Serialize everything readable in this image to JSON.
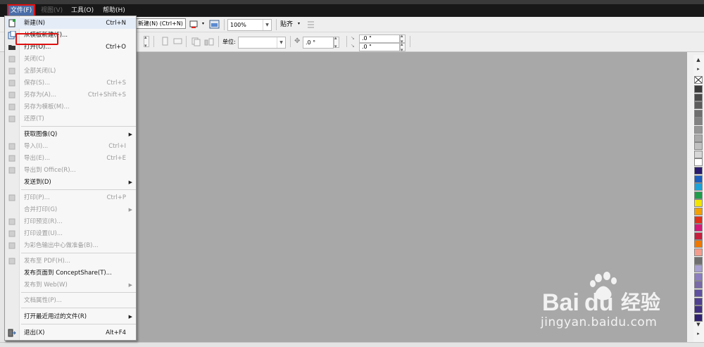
{
  "menubar": {
    "items": [
      {
        "label": "文件(F)",
        "state": "active"
      },
      {
        "label": "视图(V)",
        "state": "disabled"
      },
      {
        "label": "工具(O)",
        "state": "normal"
      },
      {
        "label": "帮助(H)",
        "state": "normal"
      }
    ]
  },
  "toolbar": {
    "tooltip": "新建(N) (Ctrl+N)",
    "zoom_value": "100%",
    "snap_label": "贴齐",
    "unit_label": "单位:",
    "unit_value": "",
    "rotate_value": ".0 °",
    "dup_x_value": ".0 \"",
    "dup_y_value": ".0 \""
  },
  "file_menu": {
    "items": [
      {
        "label": "新建(N)",
        "shortcut": "Ctrl+N",
        "enabled": true,
        "submenu": false,
        "icon": "new-document-icon"
      },
      {
        "label": "从模板新建(F)...",
        "shortcut": "",
        "enabled": true,
        "submenu": false,
        "icon": "template-icon"
      },
      {
        "label": "打开(O)...",
        "shortcut": "Ctrl+O",
        "enabled": true,
        "submenu": false,
        "icon": "open-folder-icon"
      },
      {
        "label": "关闭(C)",
        "shortcut": "",
        "enabled": false,
        "submenu": false,
        "icon": "close-document-icon"
      },
      {
        "label": "全部关闭(L)",
        "shortcut": "",
        "enabled": false,
        "submenu": false,
        "icon": "close-all-icon"
      },
      {
        "label": "保存(S)...",
        "shortcut": "Ctrl+S",
        "enabled": false,
        "submenu": false,
        "icon": "save-icon"
      },
      {
        "label": "另存为(A)...",
        "shortcut": "Ctrl+Shift+S",
        "enabled": false,
        "submenu": false,
        "icon": "save-as-icon"
      },
      {
        "label": "另存为模板(M)...",
        "shortcut": "",
        "enabled": false,
        "submenu": false,
        "icon": "save-template-icon"
      },
      {
        "label": "还原(T)",
        "shortcut": "",
        "enabled": false,
        "submenu": false,
        "icon": "revert-icon"
      },
      {
        "label": "获取图像(Q)",
        "shortcut": "",
        "enabled": true,
        "submenu": true,
        "icon": ""
      },
      {
        "label": "导入(I)...",
        "shortcut": "Ctrl+I",
        "enabled": false,
        "submenu": false,
        "icon": "import-icon"
      },
      {
        "label": "导出(E)...",
        "shortcut": "Ctrl+E",
        "enabled": false,
        "submenu": false,
        "icon": "export-icon"
      },
      {
        "label": "导出到 Office(R)...",
        "shortcut": "",
        "enabled": false,
        "submenu": false,
        "icon": "export-office-icon"
      },
      {
        "label": "发送到(D)",
        "shortcut": "",
        "enabled": true,
        "submenu": true,
        "icon": ""
      },
      {
        "label": "打印(P)...",
        "shortcut": "Ctrl+P",
        "enabled": false,
        "submenu": false,
        "icon": "print-icon"
      },
      {
        "label": "合并打印(G)",
        "shortcut": "",
        "enabled": false,
        "submenu": true,
        "icon": ""
      },
      {
        "label": "打印预览(R)...",
        "shortcut": "",
        "enabled": false,
        "submenu": false,
        "icon": "print-preview-icon"
      },
      {
        "label": "打印设置(U)...",
        "shortcut": "",
        "enabled": false,
        "submenu": false,
        "icon": "print-setup-icon"
      },
      {
        "label": "为彩色输出中心做准备(B)...",
        "shortcut": "",
        "enabled": false,
        "submenu": false,
        "icon": "color-output-icon"
      },
      {
        "label": "发布至 PDF(H)...",
        "shortcut": "",
        "enabled": false,
        "submenu": false,
        "icon": "publish-pdf-icon"
      },
      {
        "label": "发布页面到 ConceptShare(T)...",
        "shortcut": "",
        "enabled": true,
        "submenu": false,
        "icon": ""
      },
      {
        "label": "发布到 Web(W)",
        "shortcut": "",
        "enabled": false,
        "submenu": true,
        "icon": ""
      },
      {
        "label": "文档属性(P)...",
        "shortcut": "",
        "enabled": false,
        "submenu": false,
        "icon": ""
      },
      {
        "label": "打开最近用过的文件(R)",
        "shortcut": "",
        "enabled": true,
        "submenu": true,
        "icon": ""
      },
      {
        "label": "退出(X)",
        "shortcut": "Alt+F4",
        "enabled": true,
        "submenu": false,
        "icon": "exit-icon"
      }
    ]
  },
  "palette": {
    "colors": [
      "#3a3a3a",
      "#4a4a4a",
      "#5c5c5c",
      "#6e6e6e",
      "#828282",
      "#969696",
      "#aaaaaa",
      "#c0c0c0",
      "#d6d6d6",
      "#ffffff",
      "#2a1a6e",
      "#1a5fbf",
      "#1aa3d9",
      "#1e9e4a",
      "#f2e600",
      "#f2a000",
      "#e0301a",
      "#d6187a",
      "#c81e3c",
      "#f07800",
      "#f49c8c",
      "#6e6e6e",
      "#a8a0d0",
      "#8c7cc0",
      "#7a6aa8",
      "#6050a0",
      "#504090",
      "#403080",
      "#302070"
    ]
  },
  "watermark": {
    "brand": "Bai du 经验",
    "url": "jingyan.baidu.com"
  }
}
